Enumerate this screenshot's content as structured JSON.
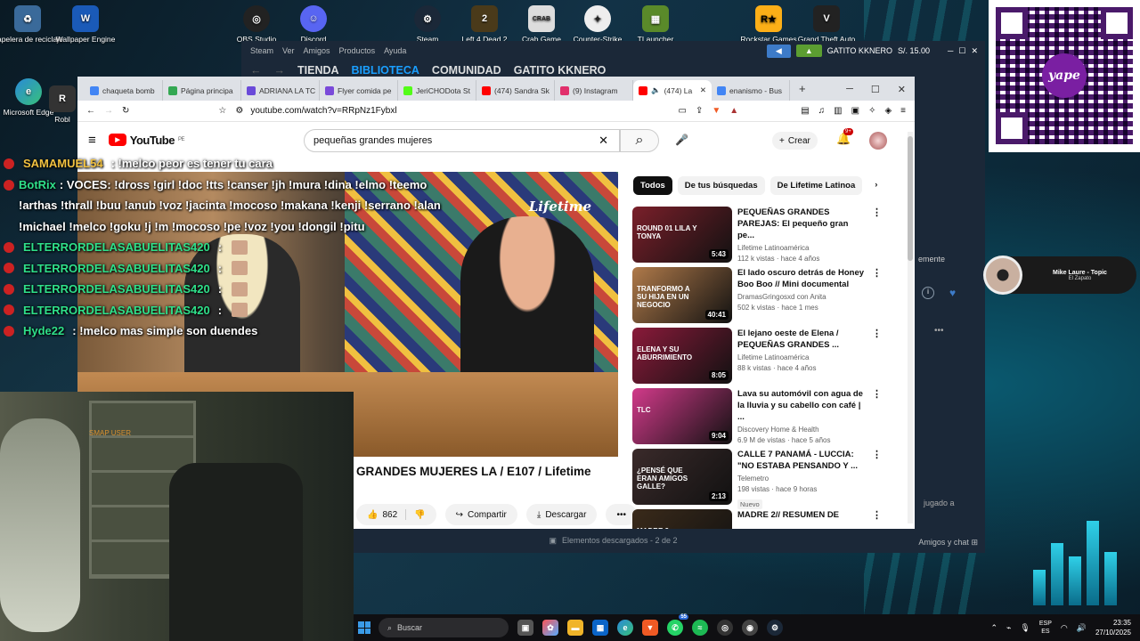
{
  "desktop": {
    "left_icons": [
      {
        "label": "Papelera de reciclaje",
        "icon": "recycle-bin-icon"
      },
      {
        "label": "Wallpaper Engine",
        "icon": "wallpaper-engine-icon"
      },
      {
        "label": "Microsoft Edge",
        "icon": "edge-icon"
      },
      {
        "label": "Robl",
        "icon": "roblox-icon"
      }
    ],
    "top_icons": [
      {
        "label": "OBS Studio",
        "icon": "obs-icon"
      },
      {
        "label": "Discord",
        "icon": "discord-icon"
      },
      {
        "label": "Steam",
        "icon": "steam-icon"
      },
      {
        "label": "Left 4 Dead 2",
        "icon": "left4dead2-icon"
      },
      {
        "label": "Crab Game",
        "icon": "crab-game-icon"
      },
      {
        "label": "Counter-Strike",
        "icon": "counter-strike-icon"
      },
      {
        "label": "TLauncher",
        "icon": "tlauncher-icon"
      },
      {
        "label": "Rockstar Games",
        "icon": "rockstar-icon"
      },
      {
        "label": "Grand Theft Auto",
        "icon": "gta-icon"
      }
    ]
  },
  "steam": {
    "menu": [
      "Steam",
      "Ver",
      "Amigos",
      "Productos",
      "Ayuda"
    ],
    "nav": [
      "TIENDA",
      "BIBLIOTECA",
      "COMUNIDAD",
      "GATITO KKNERO"
    ],
    "user": "GATITO KKNERO",
    "balance": "S/. 15.00",
    "downloads": "Elementos descargados - 2 de 2",
    "friends": "Amigos y chat",
    "side_text": "emente",
    "side_text2": "jugado a"
  },
  "browser": {
    "tabs": [
      {
        "label": "chaqueta bomb",
        "color": "#4285f4"
      },
      {
        "label": "Página principa",
        "color": "#34a853"
      },
      {
        "label": "ADRIANA LA TC",
        "color": "#6a4ad9"
      },
      {
        "label": "Flyer comida pe",
        "color": "#7a4ad9"
      },
      {
        "label": "JeriCHODota St",
        "color": "#53fc18"
      },
      {
        "label": "(474) Sandra Sk",
        "color": "#ff0000"
      },
      {
        "label": "(9) Instagram",
        "color": "#e1306c"
      },
      {
        "label": "(474) La",
        "color": "#ff0000"
      },
      {
        "label": "enanismo - Bus",
        "color": "#4285f4"
      }
    ],
    "url": "youtube.com/watch?v=RRpNz1Fybxl"
  },
  "youtube": {
    "logo": "YouTube",
    "region": "PE",
    "search_value": "pequeñas grandes mujeres",
    "create_label": "Crear",
    "notif_count": "9+",
    "video_title": "GRANDES MUJERES LA / E107 / Lifetime",
    "watermark": "Lifetime",
    "likes": "862",
    "share_label": "Compartir",
    "download_label": "Descargar",
    "chips": [
      "Todos",
      "De tus búsquedas",
      "De Lifetime Latinoa"
    ],
    "recommendations": [
      {
        "title": "PEQUEÑAS GRANDES PAREJAS: El pequeño gran pe...",
        "channel": "Lifetime Latinoamérica",
        "meta": "112 k vistas · hace 4 años",
        "duration": "5:43",
        "thumb": "#7a1f2a",
        "overlay": "ROUND 01 LILA Y TONYA"
      },
      {
        "title": "El lado oscuro detrás de Honey Boo Boo // Mini documental",
        "channel": "DramasGringosxd con Anita",
        "meta": "502 k vistas · hace 1 mes",
        "duration": "40:41",
        "thumb": "#b07a4a",
        "overlay": "TRANFORMO A SU HIJA EN UN NEGOCIO"
      },
      {
        "title": "El lejano oeste de Elena / PEQUEÑAS GRANDES ...",
        "channel": "Lifetime Latinoamérica",
        "meta": "88 k vistas · hace 4 años",
        "duration": "8:05",
        "thumb": "#8a1a3a",
        "overlay": "ELENA Y SU ABURRIMIENTO"
      },
      {
        "title": "Lava su automóvil con agua de la lluvia y su cabello con café | ...",
        "channel": "Discovery Home & Health",
        "meta": "6.9 M de vistas · hace 5 años",
        "duration": "9:04",
        "thumb": "#d23a8a",
        "overlay": "TLC"
      },
      {
        "title": "CALLE 7 PANAMÁ - LUCCIA: \"NO ESTABA PENSANDO Y ...",
        "channel": "Telemetro",
        "meta": "198 vistas · hace 9 horas",
        "duration": "2:13",
        "thumb": "#3a2a2a",
        "overlay": "¿PENSÉ QUE ERAN AMIGOS GALLE?",
        "badge": "Nuevo"
      },
      {
        "title": "MADRE 2// RESUMEN DE",
        "channel": "",
        "meta": "",
        "duration": "",
        "thumb": "#3a2a1a",
        "overlay": "MADRE 2"
      }
    ]
  },
  "chat": [
    {
      "name": "SAMAMUEL54",
      "msg": ": !melco peor es tener tu cara",
      "color": "#f0c040"
    },
    {
      "name": "BotRix",
      "msg": ": VOCES: !dross !girl !doc !tts !canser !jh !mura !dina !elmo !teemo !arthas !thrall !buu !anub !voz !jacinta !mocoso !makana !kenji !serrano !alan !michael !melco !goku !j !m !mocoso !pe !voz !you !dongil !pitu",
      "color": "#2fe08a"
    },
    {
      "name": "ELTERRORDELASABUELITAS420",
      "msg": ":",
      "color": "#2fe08a",
      "emote": true
    },
    {
      "name": "ELTERRORDELASABUELITAS420",
      "msg": ":",
      "color": "#2fe08a",
      "emote": true
    },
    {
      "name": "ELTERRORDELASABUELITAS420",
      "msg": ":",
      "color": "#2fe08a",
      "emote": true
    },
    {
      "name": "ELTERRORDELASABUELITAS420",
      "msg": ":",
      "color": "#2fe08a",
      "emote": true
    },
    {
      "name": "Hyde22",
      "msg": ": !melco mas simple son duendes",
      "color": "#2fe08a"
    }
  ],
  "webcam": {
    "label": "SMAP USER"
  },
  "qr": {
    "brand": "yape"
  },
  "music": {
    "title": "Mike Laure - Topic",
    "subtitle": "El Zapato"
  },
  "taskbar": {
    "search_placeholder": "Buscar",
    "whatsapp_badge": "55",
    "lang": "ESP",
    "lang2": "ES",
    "time": "23:35",
    "date": "27/10/2025"
  }
}
